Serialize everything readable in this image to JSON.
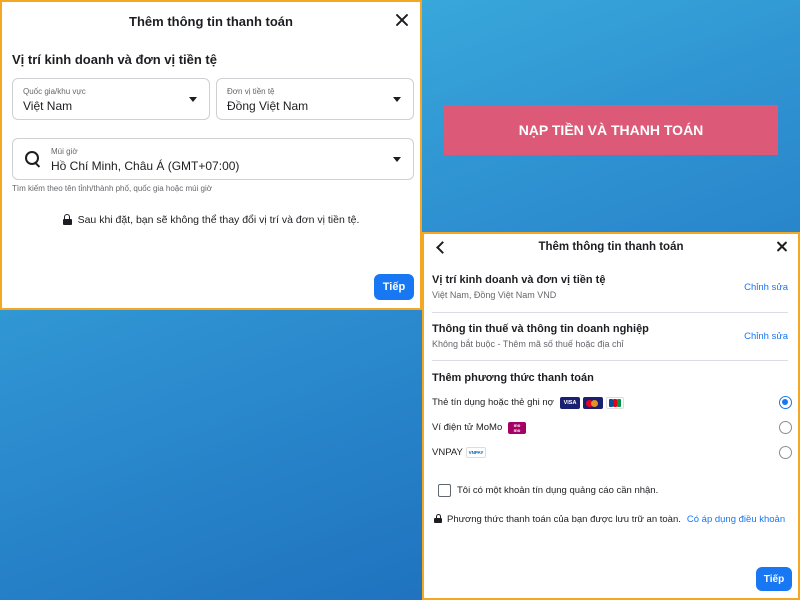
{
  "dialog1": {
    "title": "Thêm thông tin thanh toán",
    "section_title": "Vị trí kinh doanh và đơn vị tiền tệ",
    "country": {
      "label": "Quốc gia/khu vực",
      "value": "Việt Nam"
    },
    "currency": {
      "label": "Đơn vị tiền tệ",
      "value": "Đồng Việt Nam"
    },
    "timezone": {
      "label": "Múi giờ",
      "value": "Hồ Chí Minh, Châu Á (GMT+07:00)",
      "hint": "Tìm kiếm theo tên tỉnh/thành phố, quốc gia hoặc múi giờ"
    },
    "lock_notice": "Sau khi đặt, bạn sẽ không thể thay đổi vị trí và đơn vị tiền tệ.",
    "next_label": "Tiếp"
  },
  "banner": {
    "label": "NẠP TIỀN VÀ THANH TOÁN",
    "color": "#dc5a78"
  },
  "dialog2": {
    "title": "Thêm thông tin thanh toán",
    "location_section": {
      "title": "Vị trí kinh doanh và đơn vị tiền tệ",
      "subtitle": "Việt Nam, Đồng Việt Nam VND",
      "edit_label": "Chỉnh sửa"
    },
    "tax_section": {
      "title": "Thông tin thuế và thông tin doanh nghiệp",
      "subtitle": "Không bắt buộc - Thêm mã số thuế hoặc địa chỉ",
      "edit_label": "Chỉnh sửa"
    },
    "payment_section": {
      "title": "Thêm phương thức thanh toán",
      "methods": [
        {
          "label": "Thẻ tín dụng hoặc thẻ ghi nợ",
          "selected": true,
          "logos": [
            "visa-logo",
            "mastercard-logo",
            "jcb-logo"
          ]
        },
        {
          "label": "Ví điện tử MoMo",
          "selected": false,
          "logos": [
            "momo-logo"
          ]
        },
        {
          "label": "VNPAY",
          "selected": false,
          "logos": [
            "vnpay-logo"
          ]
        }
      ]
    },
    "credit_checkbox_label": "Tôi có một khoản tín dụng quảng cáo cần nhận.",
    "secure_notice": "Phương thức thanh toán của bạn được lưu trữ an toàn.",
    "terms_link": "Có áp dụng điều khoản",
    "next_label": "Tiếp"
  },
  "logo_text": {
    "visa": "VISA",
    "momo_top": "mo",
    "momo_bottom": "mo",
    "vnpay": "VNPAY"
  },
  "colors": {
    "accent": "#1877f2",
    "dialog_border": "#f5a623"
  }
}
